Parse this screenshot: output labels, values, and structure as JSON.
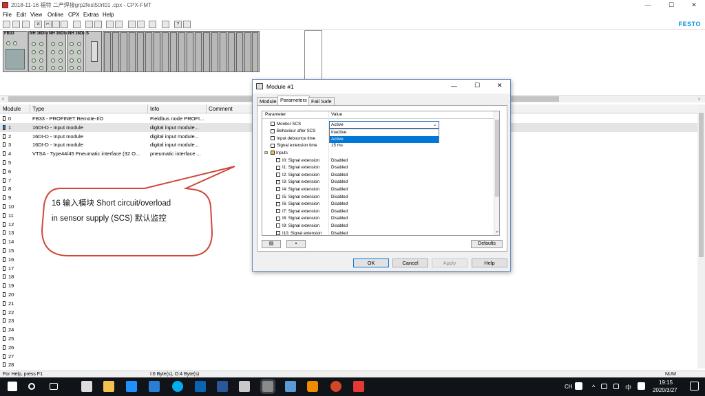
{
  "window": {
    "title": "2018-11-16 福特 二产焊接grp2fest50rt01 .cpx - CPX-FMT",
    "minimize": "—",
    "maximize": "☐",
    "close": "✕"
  },
  "menu": [
    "File",
    "Edit",
    "View",
    "Online",
    "CPX",
    "Extras",
    "Help"
  ],
  "brand": "FESTO",
  "hardware": {
    "modules": [
      "FB33",
      "NH 16DI-D",
      "NH 16DI-D",
      "NH 16DI-D",
      "S"
    ]
  },
  "table": {
    "headers": [
      "Module",
      "Type",
      "Info",
      "Comment"
    ],
    "rows": [
      {
        "module": "0",
        "type": "FB33 - PROFINET Remote-I/O",
        "info": "Fieldbus node PROFI..."
      },
      {
        "module": "1",
        "type": "16DI-D - Input module",
        "info": "digital input module..."
      },
      {
        "module": "2",
        "type": "16DI-D - Input module",
        "info": "digital input module..."
      },
      {
        "module": "3",
        "type": "16DI-D - Input module",
        "info": "digital input module..."
      },
      {
        "module": "4",
        "type": "VTSA - Type44/45 Pneumatic interface (32 O...",
        "info": "pneumatic interface ..."
      },
      {
        "module": "5",
        "type": "",
        "info": ""
      },
      {
        "module": "6",
        "type": "",
        "info": ""
      },
      {
        "module": "7",
        "type": "",
        "info": ""
      },
      {
        "module": "8",
        "type": "",
        "info": ""
      },
      {
        "module": "9",
        "type": "",
        "info": ""
      },
      {
        "module": "10",
        "type": "",
        "info": ""
      },
      {
        "module": "11",
        "type": "",
        "info": ""
      },
      {
        "module": "12",
        "type": "",
        "info": ""
      },
      {
        "module": "13",
        "type": "",
        "info": ""
      },
      {
        "module": "14",
        "type": "",
        "info": ""
      },
      {
        "module": "15",
        "type": "",
        "info": ""
      },
      {
        "module": "16",
        "type": "",
        "info": ""
      },
      {
        "module": "17",
        "type": "",
        "info": ""
      },
      {
        "module": "18",
        "type": "",
        "info": ""
      },
      {
        "module": "19",
        "type": "",
        "info": ""
      },
      {
        "module": "20",
        "type": "",
        "info": ""
      },
      {
        "module": "21",
        "type": "",
        "info": ""
      },
      {
        "module": "22",
        "type": "",
        "info": ""
      },
      {
        "module": "23",
        "type": "",
        "info": ""
      },
      {
        "module": "24",
        "type": "",
        "info": ""
      },
      {
        "module": "25",
        "type": "",
        "info": ""
      },
      {
        "module": "26",
        "type": "",
        "info": ""
      },
      {
        "module": "27",
        "type": "",
        "info": ""
      },
      {
        "module": "28",
        "type": "",
        "info": ""
      }
    ]
  },
  "statusbar": {
    "help": "For Help, press F1",
    "io": "I:6 Byte(s), O:4 Byte(s)",
    "num": "NUM"
  },
  "callout": {
    "line1": "16 输入模块 Short circuit/overload",
    "line2": "in sensor supply (SCS) 默认监控"
  },
  "dialog": {
    "title": "Module #1",
    "tabs": [
      "Module",
      "Parameters",
      "Fail Safe"
    ],
    "grid_headers": [
      "Parameter",
      "Value"
    ],
    "params": [
      {
        "name": "Monitor SCS",
        "value": "",
        "indent": 1
      },
      {
        "name": "Behaviour after SCS",
        "value": "",
        "indent": 1
      },
      {
        "name": "Input debounce time",
        "value": "",
        "indent": 1
      },
      {
        "name": "Signal extension time",
        "value": "15 ms",
        "indent": 1
      },
      {
        "name": "Inputs",
        "value": "",
        "indent": 0,
        "folder": true
      },
      {
        "name": "I0: Signal extension",
        "value": "Disabled",
        "indent": 2
      },
      {
        "name": "I1: Signal extension",
        "value": "Disabled",
        "indent": 2
      },
      {
        "name": "I2: Signal extension",
        "value": "Disabled",
        "indent": 2
      },
      {
        "name": "I3: Signal extension",
        "value": "Disabled",
        "indent": 2
      },
      {
        "name": "I4: Signal extension",
        "value": "Disabled",
        "indent": 2
      },
      {
        "name": "I5: Signal extension",
        "value": "Disabled",
        "indent": 2
      },
      {
        "name": "I6: Signal extension",
        "value": "Disabled",
        "indent": 2
      },
      {
        "name": "I7: Signal extension",
        "value": "Disabled",
        "indent": 2
      },
      {
        "name": "I8: Signal extension",
        "value": "Disabled",
        "indent": 2
      },
      {
        "name": "I9: Signal extension",
        "value": "Disabled",
        "indent": 2
      },
      {
        "name": "I10: Signal extension",
        "value": "Disabled",
        "indent": 2
      }
    ],
    "dropdown": {
      "current": "Active",
      "options": [
        "Inactive",
        "Active"
      ],
      "selected_index": 1
    },
    "defaults_button": "Defaults",
    "buttons": [
      "OK",
      "Cancel",
      "Apply",
      "Help"
    ]
  },
  "taskbar": {
    "lang": "CH",
    "ime": "中",
    "time": "19:15",
    "date": "2020/3/27"
  },
  "colors": {
    "selection": "#0078d7",
    "festo_blue": "#0091dc",
    "taskbar": "#101418"
  }
}
